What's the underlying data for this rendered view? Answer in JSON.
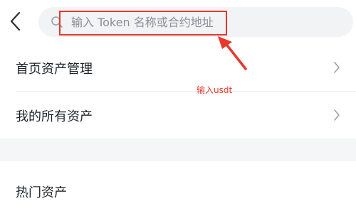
{
  "search": {
    "placeholder": "输入 Token 名称或合约地址",
    "value": ""
  },
  "icons": {
    "back": "back-arrow-icon",
    "search": "search-icon",
    "chevron": "chevron-right-icon"
  },
  "menu": {
    "items": [
      {
        "label": "首页资产管理"
      },
      {
        "label": "我的所有资产"
      }
    ]
  },
  "section": {
    "hot_assets_label": "热门资产"
  },
  "annotation": {
    "text": "输入usdt"
  },
  "colors": {
    "annotation": "#e8382c",
    "search_background": "#f2f3f5",
    "section_gap": "#f5f6f8"
  }
}
